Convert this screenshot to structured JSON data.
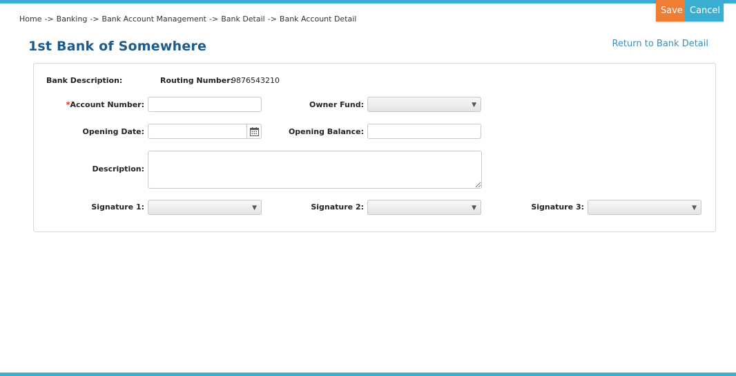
{
  "breadcrumb": {
    "items": [
      "Home",
      "Banking",
      "Bank Account Management",
      "Bank Detail",
      "Bank Account Detail"
    ],
    "separator": "->"
  },
  "actions": {
    "save_label": "Save",
    "cancel_label": "Cancel"
  },
  "page": {
    "title": "1st Bank of Somewhere",
    "return_link": "Return to Bank Detail"
  },
  "form": {
    "bank_description_label": "Bank Description:",
    "routing_number_label": "Routing Number:",
    "routing_number_value": "9876543210",
    "account_number_label": "Account Number:",
    "account_number_required_mark": "*",
    "account_number_value": "",
    "owner_fund_label": "Owner Fund:",
    "owner_fund_value": "",
    "opening_date_label": "Opening Date:",
    "opening_date_value": "",
    "opening_balance_label": "Opening Balance:",
    "opening_balance_value": "",
    "description_label": "Description:",
    "description_value": "",
    "signature1_label": "Signature 1:",
    "signature1_value": "",
    "signature2_label": "Signature 2:",
    "signature2_value": "",
    "signature3_label": "Signature 3:",
    "signature3_value": ""
  },
  "icons": {
    "calendar": "calendar-icon",
    "dropdown": "chevron-down-icon"
  },
  "colors": {
    "accent": "#3aaed0",
    "save": "#ef7d33",
    "title": "#1d5a8c",
    "link": "#3a8fb9",
    "required": "#d9261c"
  }
}
